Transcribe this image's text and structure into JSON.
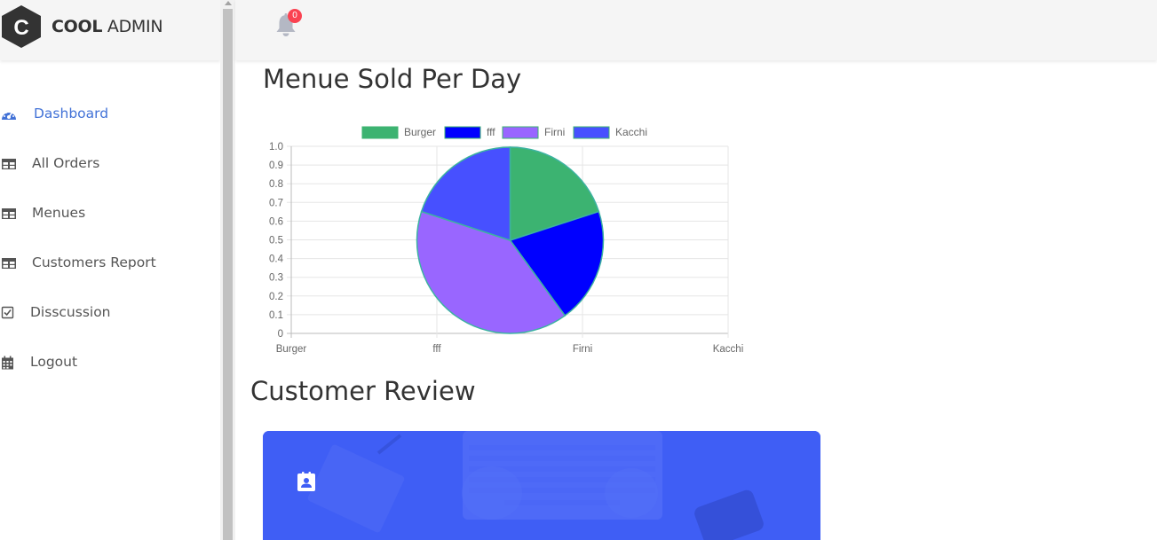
{
  "brand": {
    "bold": "COOL",
    "light": "ADMIN"
  },
  "notifications": {
    "count": "0"
  },
  "sidebar": {
    "items": [
      {
        "label": "Dashboard",
        "icon": "dashboard-icon"
      },
      {
        "label": "All Orders",
        "icon": "table-icon"
      },
      {
        "label": "Menues",
        "icon": "table-icon"
      },
      {
        "label": "Customers Report",
        "icon": "table-icon"
      },
      {
        "label": "Disscussion",
        "icon": "check-square-icon"
      },
      {
        "label": "Logout",
        "icon": "calendar-icon"
      }
    ]
  },
  "main": {
    "chart_heading": "Menue Sold Per Day",
    "review_heading": "Customer Review"
  },
  "colors": {
    "accent": "#4272d7",
    "badge": "#fa4251",
    "card": "#3f5ef5",
    "burger": "#3cb371",
    "fff": "#0000ff",
    "firni": "#9966ff",
    "kacchi": "#4750ff"
  },
  "chart_data": {
    "type": "pie",
    "categories": [
      "Burger",
      "fff",
      "Firni",
      "Kacchi"
    ],
    "values": [
      1,
      1,
      2,
      1
    ],
    "colors": [
      "#3cb371",
      "#0000ff",
      "#9966ff",
      "#4750ff"
    ],
    "legend": [
      "Burger",
      "fff",
      "Firni",
      "Kacchi"
    ],
    "legend_position": "top",
    "y_ticks": [
      "1.0",
      "0.9",
      "0.8",
      "0.7",
      "0.6",
      "0.5",
      "0.4",
      "0.3",
      "0.2",
      "0.1",
      "0"
    ],
    "x_ticks": [
      "Burger",
      "fff",
      "Firni",
      "Kacchi"
    ],
    "ylim": [
      0,
      1
    ],
    "grid": true
  }
}
